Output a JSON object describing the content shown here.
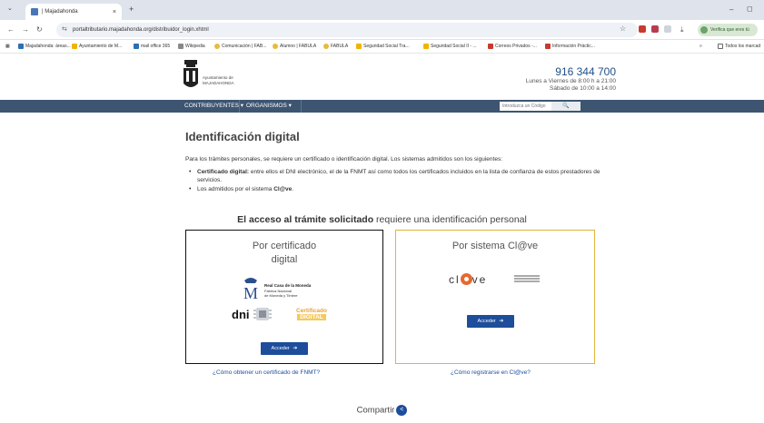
{
  "browser": {
    "tab_title": "| Majadahonda",
    "tab_close": "×",
    "new_tab": "+",
    "url": "portaltributario.majadahonda.org/distribuidor_login.xhtml",
    "verify_label": "Verifica que eres tú",
    "bookmarks": [
      "Majadahonda: áreas...",
      "Ayuntamiento de M...",
      "mail office 365",
      "Wikipedia",
      "Comunicación | FAB...",
      "Alumno | FABULA",
      "FABULA",
      "Seguridad Social Tra...",
      "Seguridad Social II - ...",
      "Correos Privados -...",
      "Información Práctic..."
    ],
    "bookmarks_all": "Todos los marcad",
    "icon_colors": {
      "tab": "#4a77b4",
      "bookmark_blue": "#2c6fb5",
      "bookmark_yellow": "#f0b400",
      "bookmark_red": "#c93a2e",
      "bookmark_green": "#3c9a48"
    }
  },
  "site": {
    "logo_name_line1": "Ayuntamiento de",
    "logo_name_line2": "MAJADAHONDA",
    "phone": "916 344 700",
    "hours_weekday": "Lunes a Viernes de 8:00 h a 21:00",
    "hours_saturday": "Sábado de 10:00 a 14:00",
    "nav": {
      "contribuyentes": "CONTRIBUYENTES ▾",
      "organismos": "ORGANISMOS ▾",
      "search_placeholder": "Introduzca un Código",
      "search_button": "🔍"
    }
  },
  "main": {
    "title": "Identificación digital",
    "intro": "Para los trámites personales, se requiere un certificado o identificación digital. Los sistemas admitidos son los siguientes:",
    "bullet1_bold": "Certificado digital:",
    "bullet1_text": " entre ellos el DNI electrónico, el de la FNMT así como todos los certificados incluidos en la lista de confianza de estos prestadores de servicios.",
    "bullet2_text": "Los admitidos por el sistema ",
    "bullet2_bold": "Cl@ve",
    "bullet2_end": ".",
    "access_bold": "El acceso al trámite solicitado",
    "access_rest": " requiere una identificación personal"
  },
  "cards": {
    "fnmt": {
      "title_line1": "Por certificado",
      "title_line2": "digital",
      "rcm_line1": "Real Casa de la Moneda",
      "rcm_line2": "Fábrica Nacional",
      "rcm_line3": "de Moneda y Timbre",
      "dni": "dni",
      "cert_line1": "Certificado",
      "cert_line2": "DIGITAL",
      "button": "Acceder",
      "help": "¿Cómo obtener un certificado de FNMT?"
    },
    "clave": {
      "title": "Por sistema Cl@ve",
      "logo_left": "cl",
      "logo_right": "ve",
      "button": "Acceder",
      "help": "¿Cómo registrarse en Cl@ve?"
    }
  },
  "footer": {
    "share": "Compartir"
  }
}
